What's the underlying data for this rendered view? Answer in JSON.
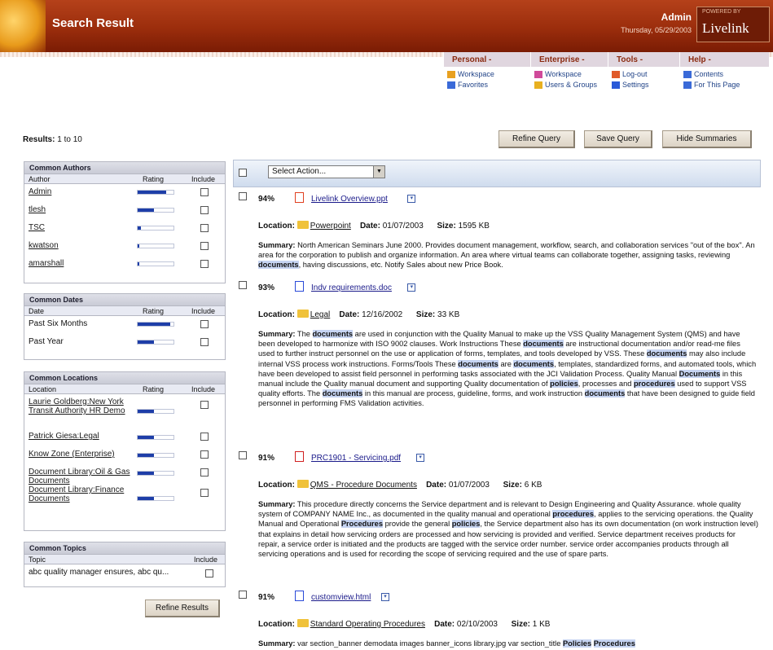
{
  "header": {
    "title": "Search Result",
    "user": "Admin",
    "date": "Thursday, 05/29/2003",
    "powered": "POWERED BY",
    "brand": "Livelink"
  },
  "menus": [
    {
      "label": "Personal -",
      "items": [
        "Workspace",
        "Favorites"
      ]
    },
    {
      "label": "Enterprise -",
      "items": [
        "Workspace",
        "Users & Groups"
      ]
    },
    {
      "label": "Tools -",
      "items": [
        "Log-out",
        "Settings"
      ]
    },
    {
      "label": "Help -",
      "items": [
        "Contents",
        "For This Page"
      ]
    }
  ],
  "results_label": "Results:",
  "results_range": "1 to 10",
  "buttons": {
    "refine_query": "Refine Query",
    "save_query": "Save Query",
    "hide_summaries": "Hide Summaries",
    "refine_results": "Refine Results"
  },
  "authors": {
    "title": "Common Authors",
    "cols": [
      "Author",
      "Rating",
      "Include"
    ],
    "rows": [
      {
        "name": "Admin",
        "rating": 0.8
      },
      {
        "name": "tlesh",
        "rating": 0.45
      },
      {
        "name": "TSC",
        "rating": 0.1
      },
      {
        "name": "kwatson",
        "rating": 0.05
      },
      {
        "name": "amarshall",
        "rating": 0.05
      }
    ]
  },
  "dates": {
    "title": "Common Dates",
    "cols": [
      "Date",
      "Rating",
      "Include"
    ],
    "rows": [
      {
        "name": "Past Six Months",
        "rating": 0.9
      },
      {
        "name": "Past Year",
        "rating": 0.45
      }
    ]
  },
  "locations": {
    "title": "Common Locations",
    "cols": [
      "Location",
      "Rating",
      "Include"
    ],
    "rows": [
      {
        "name": "Laurie Goldberg:New York Transit Authority HR Demo",
        "rating": 0.45
      },
      {
        "name": "Patrick Giesa:Legal",
        "rating": 0.45
      },
      {
        "name": "Know Zone (Enterprise)",
        "rating": 0.45
      },
      {
        "name": "Document Library:Oil & Gas Documents",
        "rating": 0.45
      },
      {
        "name": "Document Library:Finance Documents",
        "rating": 0.45
      }
    ]
  },
  "topics": {
    "title": "Common Topics",
    "cols": [
      "Topic",
      "Include"
    ],
    "rows": [
      "abc quality manager ensures, abc qu..."
    ]
  },
  "select_action": "Select Action...",
  "labels": {
    "location": "Location:",
    "date": "Date:",
    "size": "Size:",
    "summary": "Summary:"
  },
  "results": [
    {
      "pct": "94%",
      "file": "Livelink Overview.ppt",
      "location": "Powerpoint",
      "date": "01/07/2003",
      "size": "1595 KB",
      "summary": [
        [
          "North American Seminars June 2000. Provides document management, workflow, search, and collaboration services \"out of the box\". An area for the corporation to publish and organize information. An area where virtual teams can collaborate together, assigning tasks, reviewing ",
          0
        ],
        [
          "documents",
          1
        ],
        [
          ", having discussions, etc. Notify Sales about new Price Book.",
          0
        ]
      ]
    },
    {
      "pct": "93%",
      "file": "Indv requirements.doc",
      "location": "Legal",
      "date": "12/16/2002",
      "size": "33 KB",
      "summary": [
        [
          "The ",
          0
        ],
        [
          "documents",
          1
        ],
        [
          " are used in conjunction with the Quality Manual to make up the VSS Quality Management System (QMS) and have been developed to harmonize with ISO 9002 clauses. Work Instructions These ",
          0
        ],
        [
          "documents",
          1
        ],
        [
          " are instructional documentation and/or read-me files used to further instruct personnel on the use or application of forms, templates, and tools developed by VSS. These ",
          0
        ],
        [
          "documents",
          1
        ],
        [
          " may also include internal VSS process work instructions. Forms/Tools These ",
          0
        ],
        [
          "documents",
          1
        ],
        [
          " are ",
          0
        ],
        [
          "documents",
          1
        ],
        [
          ", templates, standardized forms, and automated tools, which have been developed to assist field personnel in performing tasks associated with the JCI Validation Process. Quality Manual ",
          0
        ],
        [
          "Documents",
          1
        ],
        [
          " in this manual include the Quality manual document and supporting Quality documentation of ",
          0
        ],
        [
          "policies",
          1
        ],
        [
          ", processes and ",
          0
        ],
        [
          "procedures",
          1
        ],
        [
          " used to support VSS quality efforts. The ",
          0
        ],
        [
          "documents",
          1
        ],
        [
          " in this manual are process, guideline, forms, and work instruction ",
          0
        ],
        [
          "documents",
          1
        ],
        [
          " that have been designed to guide field personnel in performing FMS Validation activities.",
          0
        ]
      ]
    },
    {
      "pct": "91%",
      "file": "PRC1901 - Servicing.pdf",
      "location": "QMS - Procedure Documents",
      "date": "01/07/2003",
      "size": "6 KB",
      "summary": [
        [
          "This procedure directly concerns the Service department and is relevant to Design Engineering and Quality Assurance. whole quality system of COMPANY NAME Inc., as documented in the quality manual and operational ",
          0
        ],
        [
          "procedures",
          1
        ],
        [
          ", applies to the servicing operations. the Quality Manual and Operational ",
          0
        ],
        [
          "Procedures",
          1
        ],
        [
          " provide the general ",
          0
        ],
        [
          "policies",
          1
        ],
        [
          ", the Service department also has its own documentation (on work instruction level) that explains in detail how servicing orders are processed and how servicing is provided and verified. Service department receives products for repair, a service order is initiated and the products are tagged with the service order number. service order accompanies products through all servicing operations and is used for recording the scope of servicing required and the use of spare parts.",
          0
        ]
      ]
    },
    {
      "pct": "91%",
      "file": "customview.html",
      "location": "Standard Operating Procedures",
      "date": "02/10/2003",
      "size": "1 KB",
      "summary": [
        [
          "var section_banner demodata images banner_icons library.jpg var section_title ",
          0
        ],
        [
          "Policies",
          1
        ],
        [
          " ",
          0
        ],
        [
          "Procedures",
          1
        ]
      ]
    }
  ],
  "colors": {
    "banner": "#9b2d0c",
    "menu_text": "#8a2a10",
    "link": "#1a1a8a",
    "highlight": "#c6d4f2",
    "rating_fill": "#1e3ea8"
  }
}
